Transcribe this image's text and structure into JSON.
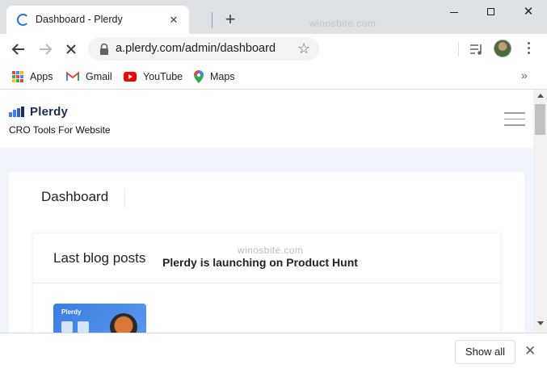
{
  "browser": {
    "tab": {
      "title": "Dashboard - Plerdy",
      "close_glyph": "✕"
    },
    "new_tab_glyph": "+",
    "watermark": "winosbite.com",
    "window_controls": {
      "close_glyph": "✕"
    },
    "address_bar": {
      "url": "a.plerdy.com/admin/dashboard",
      "star_glyph": "☆"
    },
    "bookmarks": [
      {
        "label": "Apps",
        "icon": "apps-grid-icon"
      },
      {
        "label": "Gmail",
        "icon": "gmail-icon"
      },
      {
        "label": "YouTube",
        "icon": "youtube-icon"
      },
      {
        "label": "Maps",
        "icon": "maps-icon"
      }
    ],
    "bookmarks_more_glyph": "»"
  },
  "site": {
    "logo_text": "Plerdy",
    "tagline": "CRO Tools For Website",
    "page_title": "Dashboard",
    "card": {
      "title": "Last blog posts",
      "watermark": "winosbite.com",
      "post": {
        "thumb_logo": "Plerdy",
        "title": "Plerdy is launching on Product Hunt"
      }
    }
  },
  "download_shelf": {
    "show_all_label": "Show all",
    "close_glyph": "✕"
  },
  "colors": {
    "chrome_frame": "#dee1e6",
    "accent_blue": "#1a73e8",
    "plerdy_navy": "#1e2b53",
    "content_bg": "#f0f4fb"
  }
}
